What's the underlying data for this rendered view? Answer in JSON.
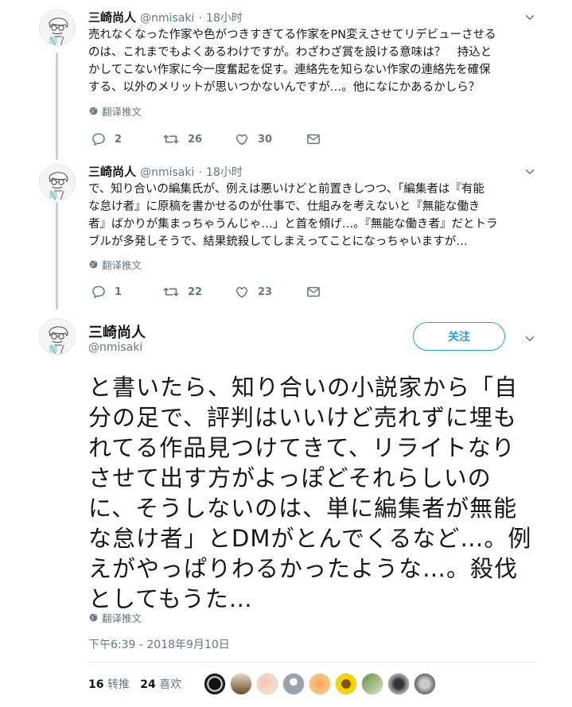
{
  "tweets": [
    {
      "name": "三崎尚人",
      "handle": "@nmisaki",
      "sep": "·",
      "time": "18小时",
      "lines": [
        "売れなくなった作家や色がつきすぎてる作家をPN変えさせてリデビューさせる",
        "のは、これまでもよくあるわけですが。わざわざ賞を設ける意味は？　持込と",
        "かしてこない作家に今一度奮起を促す。連絡先を知らない作家の連絡先を確保",
        "する、以外のメリットが思いつかないんですが…。他になにかあるかしら？"
      ],
      "translate": "翻译推文",
      "replies": "2",
      "retweets": "26",
      "likes": "30"
    },
    {
      "name": "三崎尚人",
      "handle": "@nmisaki",
      "sep": "·",
      "time": "18小时",
      "lines": [
        "で、知り合いの編集氏が、例えは悪いけどと前置きしつつ、「編集者は『有能",
        "な怠け者』に原稿を書かせるのが仕事で、仕組みを考えないと『無能な働き",
        "者』ばかりが集まっちゃうんじゃ…」と首を傾げ…。『無能な働き者』だとトラ",
        "ブルが多発しそうで、結果銃殺してしまえってことになっちゃいますが…"
      ],
      "translate": "翻译推文",
      "replies": "1",
      "retweets": "22",
      "likes": "23"
    }
  ],
  "main": {
    "name": "三崎尚人",
    "handle": "@nmisaki",
    "follow_label": "关注",
    "lines": [
      "と書いたら、知り合いの小説家から「自",
      "分の足で、評判はいいけど売れずに埋も",
      "れてる作品見つけてきて、リライトなり",
      "させて出す方がよっぽどそれらしいの",
      "に、そうしないのは、単に編集者が無能",
      "な怠け者」とDMがとんでくるなど…。例",
      "えがやっぱりわるかったような…。殺伐",
      "としてもうた…"
    ],
    "translate": "翻译推文",
    "timestamp": "下午6:39 - 2018年9月10日",
    "retweet_count": "16",
    "retweet_label": "转推",
    "like_count": "24",
    "like_label": "喜欢"
  },
  "colors": {
    "accent": "#1da1f2",
    "muted": "#657786",
    "text": "#14171a",
    "thread_line": "#c4cfd6"
  },
  "icons": [
    "reply-icon",
    "retweet-icon",
    "like-icon",
    "message-icon",
    "globe-icon",
    "chevron-down-icon"
  ]
}
